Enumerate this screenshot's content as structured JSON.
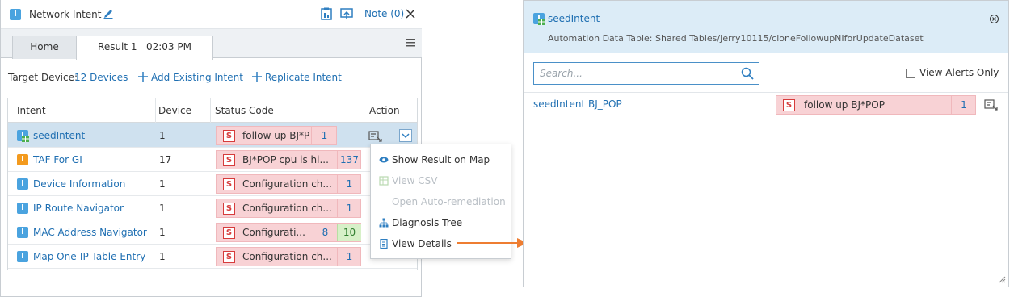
{
  "left": {
    "title": "Network Intent",
    "note_label": "Note (0)",
    "tabs": [
      {
        "label": "Home"
      },
      {
        "label": "Result 1   02:03 PM"
      }
    ],
    "toolbar": {
      "target_label": "Target Device:",
      "target_value": "12 Devices",
      "add_existing": "Add Existing Intent",
      "replicate": "Replicate Intent"
    },
    "columns": [
      "Intent",
      "Device",
      "Status Code",
      "Action"
    ],
    "rows": [
      {
        "intent": "seedIntent",
        "device": "1",
        "status": "follow up BJ*POP",
        "count": "1",
        "count2": ""
      },
      {
        "intent": "TAF For GI",
        "device": "17",
        "status": "BJ*POP cpu is hi...",
        "count": "137",
        "count2": ""
      },
      {
        "intent": "Device Information",
        "device": "1",
        "status": "Configuration ch...",
        "count": "1",
        "count2": ""
      },
      {
        "intent": "IP Route Navigator",
        "device": "1",
        "status": "Configuration ch...",
        "count": "1",
        "count2": ""
      },
      {
        "intent": "MAC Address Navigator",
        "device": "1",
        "status": "Configurati...",
        "count": "8",
        "count2": "10"
      },
      {
        "intent": "Map One-IP Table Entry",
        "device": "1",
        "status": "Configuration ch...",
        "count": "1",
        "count2": ""
      }
    ],
    "badge_letter": "I",
    "status_letter": "S"
  },
  "context_menu": {
    "items": [
      {
        "label": "Show Result on Map",
        "enabled": true
      },
      {
        "label": "View CSV",
        "enabled": false
      },
      {
        "label": "Open Auto-remediation",
        "enabled": false
      },
      {
        "label": "Diagnosis Tree",
        "enabled": true
      },
      {
        "label": "View Details",
        "enabled": true
      }
    ]
  },
  "right": {
    "title": "seedIntent",
    "subtitle": "Automation Data Table: Shared Tables/Jerry10115/cloneFollowupNIforUpdateDataset",
    "search_placeholder": "Search...",
    "view_alerts_label": "View Alerts Only",
    "row": {
      "name": "seedIntent BJ_POP",
      "status": "follow up BJ*POP",
      "count": "1"
    }
  },
  "colors": {
    "accent": "#1f6fb2",
    "status_red": "#f8d2d5",
    "arrow": "#ee7d31",
    "header_blue": "#dcecf7"
  }
}
